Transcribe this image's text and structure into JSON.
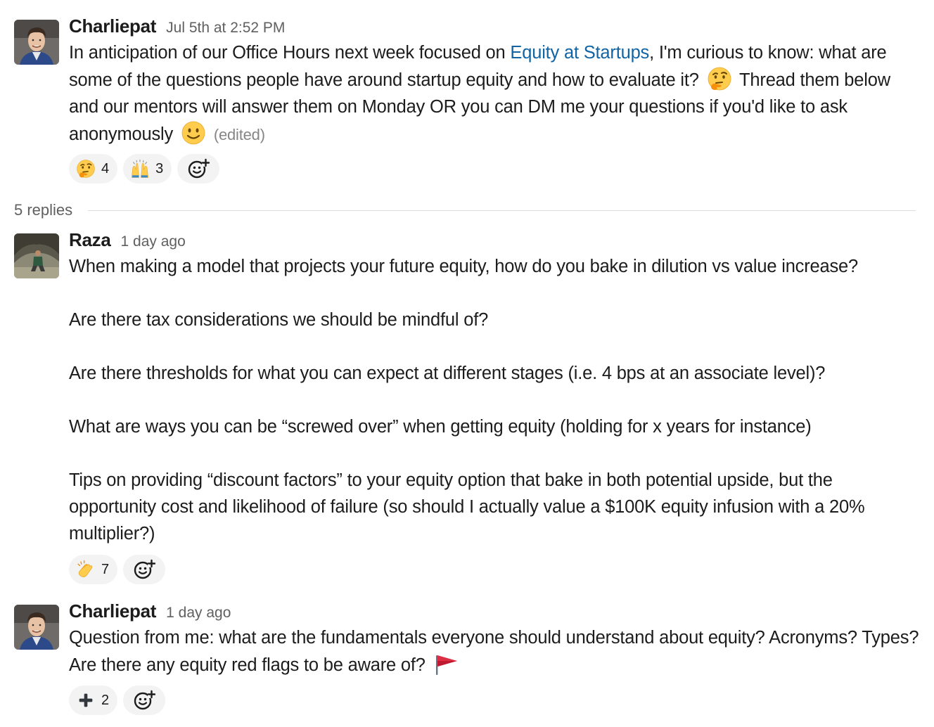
{
  "messages": [
    {
      "author": "Charliepat",
      "timestamp": "Jul 5th at 2:52 PM",
      "text_before_link": "In anticipation of our Office Hours next week focused on ",
      "link": "Equity at Startups",
      "text_after_link": ", I'm curious to know: what are some of the questions people have around startup equity and how to evaluate it? ",
      "inline_emoji_1": "thinking-face",
      "text_after_emoji_1": " Thread them below and our mentors will answer them on Monday OR you can DM me your questions if you'd like to ask anonymously ",
      "inline_emoji_2": "slightly-smiling-face",
      "edited_label": "(edited)",
      "reactions": [
        {
          "emoji": "thinking-face",
          "count": "4"
        },
        {
          "emoji": "raised-hands",
          "count": "3"
        }
      ]
    },
    {
      "author": "Raza",
      "timestamp": "1 day ago",
      "paragraphs": [
        "When making a model that projects your future equity, how do you bake in dilution vs value increase?",
        "Are there tax considerations we should be mindful of?",
        "Are there thresholds for what you can expect at different stages (i.e. 4 bps at an associate level)?",
        "What are ways you can be “screwed over” when getting equity (holding for x years for instance)",
        "Tips on providing “discount factors” to your equity option that bake in both potential upside, but the opportunity cost and likelihood of failure (so should I actually value a $100K equity infusion with a 20% multiplier?)"
      ],
      "reactions": [
        {
          "emoji": "clapping-hands",
          "count": "7"
        }
      ]
    },
    {
      "author": "Charliepat",
      "timestamp": "1 day ago",
      "text": "Question from me: what are the fundamentals everyone should understand about equity? Acronyms? Types? Are there any equity red flags to be aware of? ",
      "inline_emoji": "triangular-red-flag",
      "reactions": [
        {
          "emoji": "heavy-plus-sign",
          "count": "2"
        }
      ]
    }
  ],
  "thread": {
    "replies_label": "5 replies"
  },
  "icons": {
    "add_reaction": "add-reaction-icon"
  },
  "colors": {
    "link": "#1264a3",
    "muted_text": "#616061",
    "reaction_bg": "#f3f3f3",
    "divider": "#dddddd"
  }
}
